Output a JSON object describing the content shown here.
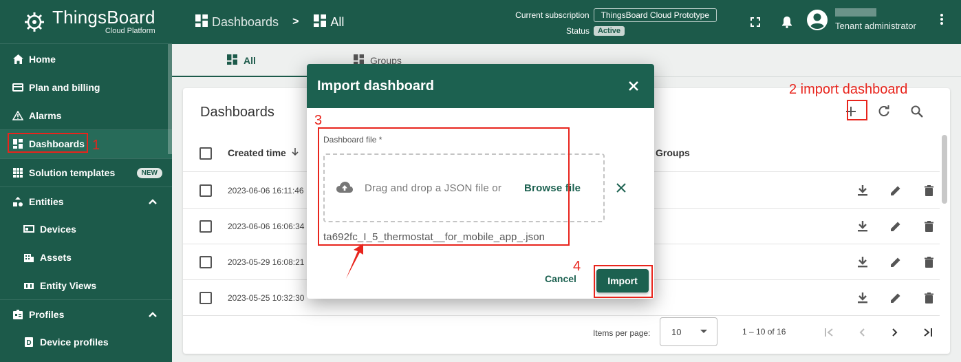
{
  "brand": {
    "title": "ThingsBoard",
    "subtitle": "Cloud Platform"
  },
  "sidebar": {
    "items": [
      {
        "label": "Home",
        "icon": "home-icon"
      },
      {
        "label": "Plan and billing",
        "icon": "billing-icon"
      },
      {
        "label": "Alarms",
        "icon": "alarm-icon"
      },
      {
        "label": "Dashboards",
        "icon": "dashboard-icon",
        "active": true
      },
      {
        "label": "Solution templates",
        "icon": "templates-icon",
        "badge": "NEW"
      },
      {
        "label": "Entities",
        "icon": "entities-icon",
        "expanded": true
      },
      {
        "label": "Devices",
        "icon": "devices-icon"
      },
      {
        "label": "Assets",
        "icon": "assets-icon"
      },
      {
        "label": "Entity Views",
        "icon": "entity-views-icon"
      },
      {
        "label": "Profiles",
        "icon": "profiles-icon",
        "expanded": true
      },
      {
        "label": "Device profiles",
        "icon": "device-profiles-icon"
      }
    ]
  },
  "header": {
    "breadcrumb": [
      "Dashboards",
      "All"
    ],
    "breadcrumb_separator": ">",
    "subscription_label": "Current subscription",
    "subscription_plan": "ThingsBoard Cloud Prototype",
    "status_label": "Status",
    "status_value": "Active",
    "user_role": "Tenant administrator"
  },
  "tabs": [
    {
      "label": "All",
      "active": true
    },
    {
      "label": "Groups",
      "active": false
    }
  ],
  "card": {
    "title": "Dashboards",
    "columns": {
      "created": "Created time",
      "groups": "Groups"
    },
    "rows": [
      {
        "created": "2023-06-06 16:11:46"
      },
      {
        "created": "2023-06-06 16:06:34"
      },
      {
        "created": "2023-05-29 16:08:21"
      },
      {
        "created": "2023-05-25 10:32:30"
      }
    ],
    "pager": {
      "items_per_page_label": "Items per page:",
      "items_per_page": "10",
      "range": "1 – 10 of 16"
    }
  },
  "dialog": {
    "title": "Import dashboard",
    "file_label": "Dashboard file *",
    "drop_text": "Drag and drop a JSON file or",
    "browse_label": "Browse file",
    "file_name": "ta692fc_I_5_thermostat__for_mobile_app_.json",
    "cancel_label": "Cancel",
    "import_label": "Import"
  },
  "annotations": {
    "step1": "1",
    "step2": "2 import dashboard",
    "step3": "3",
    "step4": "4"
  },
  "colors": {
    "primary": "#1c5a4a",
    "dialog_header": "#1c6150",
    "annotation_red": "#e8241c"
  }
}
